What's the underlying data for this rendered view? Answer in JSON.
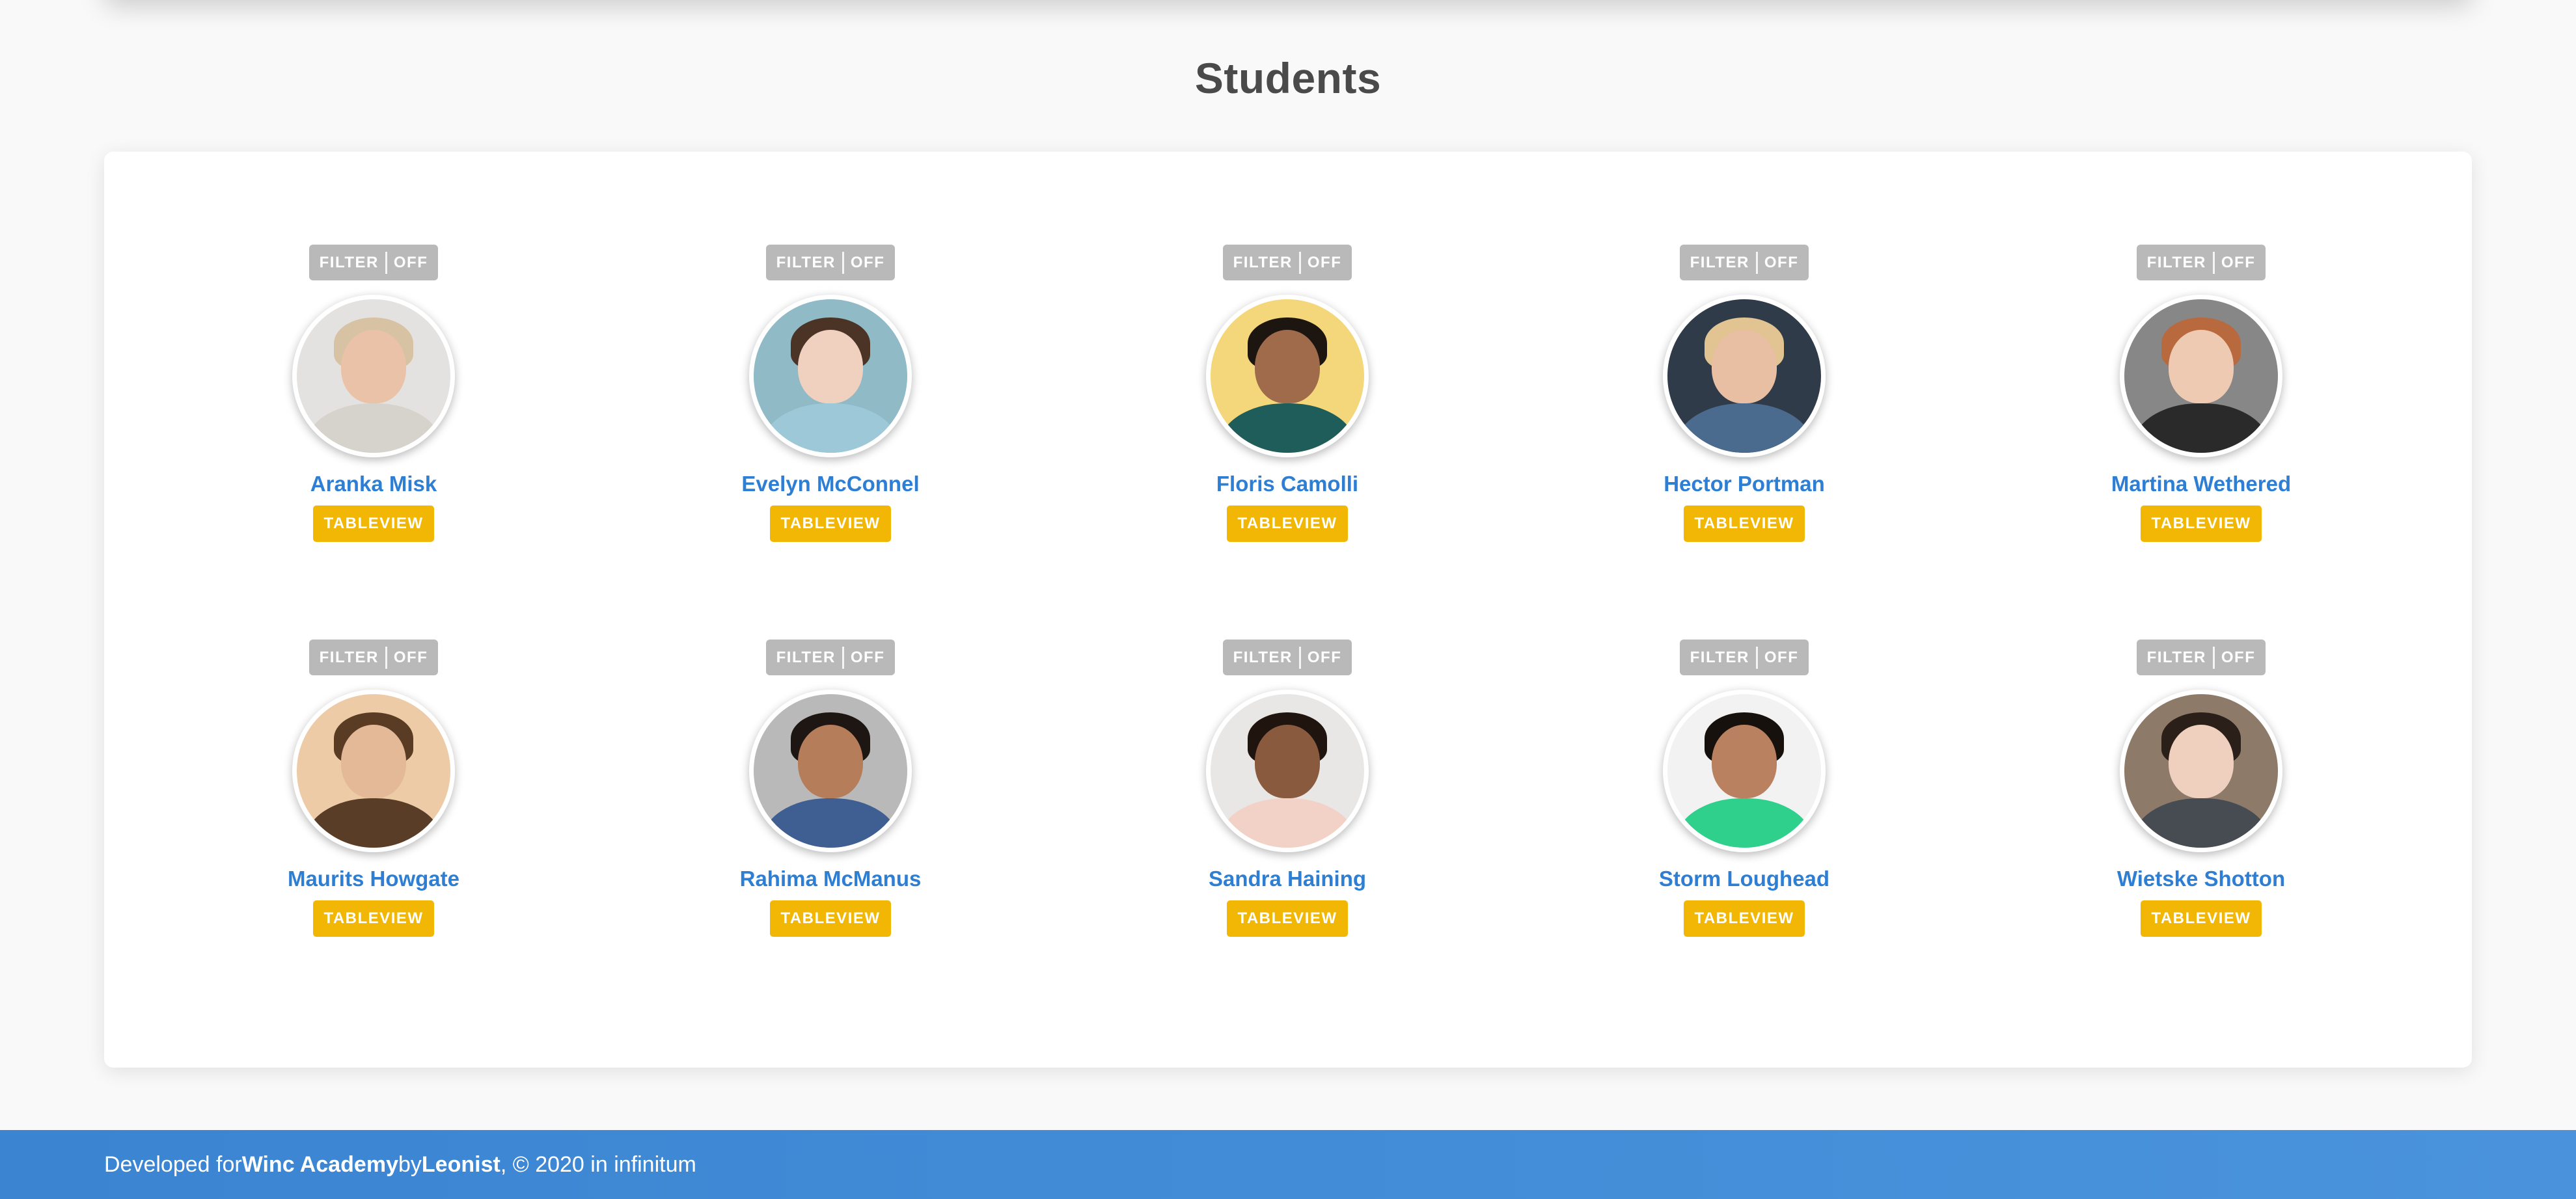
{
  "page": {
    "title": "Students"
  },
  "students": [
    {
      "name": "Aranka Misk",
      "filter_label": "FILTER",
      "filter_state": "OFF",
      "button_label": "TABLEVIEW",
      "colors": {
        "bg": "#e4e2e0",
        "skin": "#e9c2a8",
        "hair": "#d7c3a3",
        "body": "#d6d2cc"
      }
    },
    {
      "name": "Evelyn McConnel",
      "filter_label": "FILTER",
      "filter_state": "OFF",
      "button_label": "TABLEVIEW",
      "colors": {
        "bg": "#8fbac6",
        "skin": "#f0d1bf",
        "hair": "#4b3426",
        "body": "#9cc8d8"
      }
    },
    {
      "name": "Floris Camolli",
      "filter_label": "FILTER",
      "filter_state": "OFF",
      "button_label": "TABLEVIEW",
      "colors": {
        "bg": "#f4d77a",
        "skin": "#a06b4a",
        "hair": "#1c1510",
        "body": "#1f5d5a"
      }
    },
    {
      "name": "Hector Portman",
      "filter_label": "FILTER",
      "filter_state": "OFF",
      "button_label": "TABLEVIEW",
      "colors": {
        "bg": "#2f3b48",
        "skin": "#e8bfa2",
        "hair": "#e2c493",
        "body": "#4a6b8e"
      }
    },
    {
      "name": "Martina Wethered",
      "filter_label": "FILTER",
      "filter_state": "OFF",
      "button_label": "TABLEVIEW",
      "colors": {
        "bg": "#878787",
        "skin": "#efcab3",
        "hair": "#b86a3e",
        "body": "#2a2a2a"
      }
    },
    {
      "name": "Maurits Howgate",
      "filter_label": "FILTER",
      "filter_state": "OFF",
      "button_label": "TABLEVIEW",
      "colors": {
        "bg": "#eccba6",
        "skin": "#e4b997",
        "hair": "#5a3b24",
        "body": "#5a3d26"
      }
    },
    {
      "name": "Rahima McManus",
      "filter_label": "FILTER",
      "filter_state": "OFF",
      "button_label": "TABLEVIEW",
      "colors": {
        "bg": "#b9b9b9",
        "skin": "#b57d59",
        "hair": "#1d1612",
        "body": "#3f5f93"
      }
    },
    {
      "name": "Sandra Haining",
      "filter_label": "FILTER",
      "filter_state": "OFF",
      "button_label": "TABLEVIEW",
      "colors": {
        "bg": "#e9e7e5",
        "skin": "#8a5a3e",
        "hair": "#20150e",
        "body": "#f2d1c6"
      }
    },
    {
      "name": "Storm Loughead",
      "filter_label": "FILTER",
      "filter_state": "OFF",
      "button_label": "TABLEVIEW",
      "colors": {
        "bg": "#f2f2f2",
        "skin": "#b98160",
        "hair": "#16110d",
        "body": "#2fd08c"
      }
    },
    {
      "name": "Wietske Shotton",
      "filter_label": "FILTER",
      "filter_state": "OFF",
      "button_label": "TABLEVIEW",
      "colors": {
        "bg": "#8d7a69",
        "skin": "#efcfbd",
        "hair": "#2b1f19",
        "body": "#474b52"
      }
    }
  ],
  "footer": {
    "prefix": "Developed for ",
    "academy": "Winc Academy",
    "by": " by ",
    "author": "Leonist",
    "suffix": ", © 2020 in infinitum"
  },
  "colors": {
    "accent_name": "#2e7fd4",
    "tableview_button": "#f2b705",
    "filter_toggle": "#b9b9b9",
    "footer_bg": "#3a84d2"
  }
}
